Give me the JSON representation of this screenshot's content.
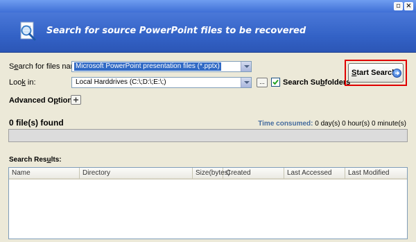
{
  "banner": {
    "title": "Search for source PowerPoint files to be recovered",
    "icon": "magnifier-document-icon"
  },
  "window_controls": {
    "close": "close-icon"
  },
  "form": {
    "search_label_pre": "S",
    "search_label_u": "e",
    "search_label_post": "arch for files named:",
    "file_type_value": "Microsoft PowerPoint presentation files (*.pptx)",
    "lookin_label_pre": "Loo",
    "lookin_label_u": "k",
    "lookin_label_post": " in:",
    "lookin_value": "Local Harddrives (C:\\;D:\\;E:\\;)",
    "browse_label": "...",
    "subfolders_label_pre": "Search Su",
    "subfolders_label_u": "b",
    "subfolders_label_post": "folders",
    "subfolders_checked": true,
    "advanced_label_pre": "Advanced O",
    "advanced_label_u": "p",
    "advanced_label_post": "tions"
  },
  "start_button": {
    "label_u": "S",
    "label_post": "tart Search"
  },
  "status": {
    "found": "0 file(s) found",
    "time_label": "Time consumed:",
    "time_value": "0 day(s) 0 hour(s) 0 minute(s)"
  },
  "results": {
    "label_pre": "Search Res",
    "label_u": "u",
    "label_post": "lts:",
    "columns": [
      "Name",
      "Directory",
      "Size(bytes)",
      "Created",
      "Last Accessed",
      "Last Modified"
    ]
  }
}
